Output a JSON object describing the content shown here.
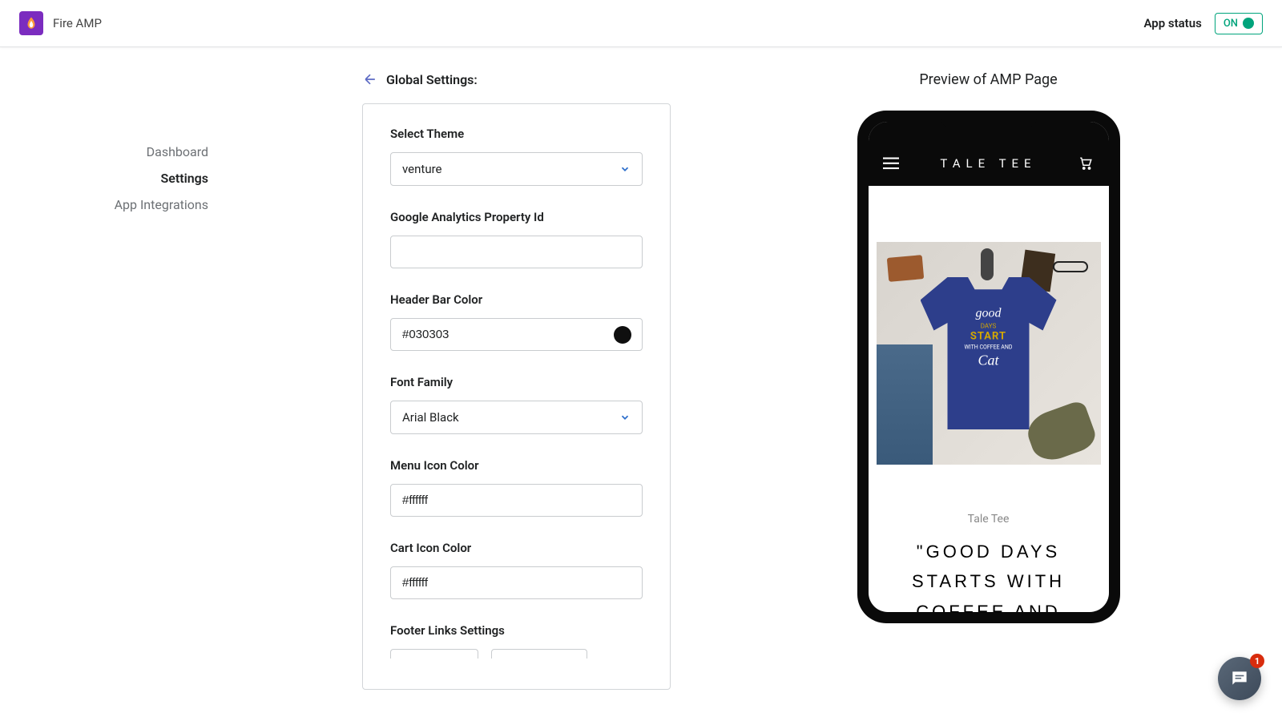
{
  "header": {
    "app_name": "Fire AMP",
    "app_status_label": "App status",
    "status_text": "ON"
  },
  "sidebar": {
    "items": [
      {
        "label": "Dashboard",
        "active": false
      },
      {
        "label": "Settings",
        "active": true
      },
      {
        "label": "App Integrations",
        "active": false
      }
    ]
  },
  "page": {
    "title": "Global Settings:"
  },
  "form": {
    "select_theme": {
      "label": "Select Theme",
      "value": "venture"
    },
    "ga_property": {
      "label": "Google Analytics Property Id",
      "value": ""
    },
    "header_bar_color": {
      "label": "Header Bar Color",
      "value": "#030303"
    },
    "font_family": {
      "label": "Font Family",
      "value": "Arial Black"
    },
    "menu_icon_color": {
      "label": "Menu Icon Color",
      "value": "#ffffff"
    },
    "cart_icon_color": {
      "label": "Cart Icon Color",
      "value": "#ffffff"
    },
    "footer_links": {
      "label": "Footer Links Settings"
    }
  },
  "preview": {
    "title": "Preview of AMP Page",
    "store_name": "TALE TEE",
    "brand": "Tale Tee",
    "product_title": "\"GOOD DAYS STARTS WITH COFFEE AND"
  },
  "chat": {
    "badge_count": "1"
  }
}
